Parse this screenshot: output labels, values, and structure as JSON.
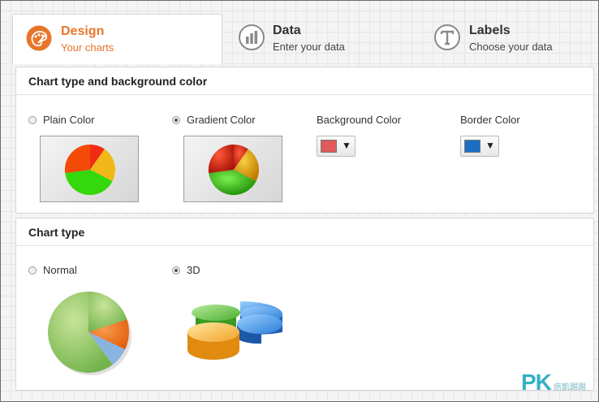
{
  "tabs": [
    {
      "title": "Design",
      "subtitle": "Your charts",
      "icon": "palette-icon",
      "active": true
    },
    {
      "title": "Data",
      "subtitle": "Enter your data",
      "icon": "bar-chart-icon",
      "active": false
    },
    {
      "title": "Labels",
      "subtitle": "Choose your data",
      "icon": "text-tool-icon",
      "active": false
    }
  ],
  "section1": {
    "title": "Chart type and background color",
    "plain_label": "Plain Color",
    "plain_selected": false,
    "gradient_label": "Gradient Color",
    "gradient_selected": true,
    "bg_color_label": "Background Color",
    "bg_color_value": "#e05a5a",
    "border_color_label": "Border Color",
    "border_color_value": "#1a6fc4",
    "dropdown_arrow": "▼"
  },
  "section2": {
    "title": "Chart type",
    "normal_label": "Normal",
    "normal_selected": false,
    "threed_label": "3D",
    "threed_selected": true
  },
  "watermark": {
    "logo": "PK",
    "text": "痞凱踢踢"
  },
  "colors": {
    "accent": "#e8752a",
    "icon_gray": "#8a8a8a"
  }
}
